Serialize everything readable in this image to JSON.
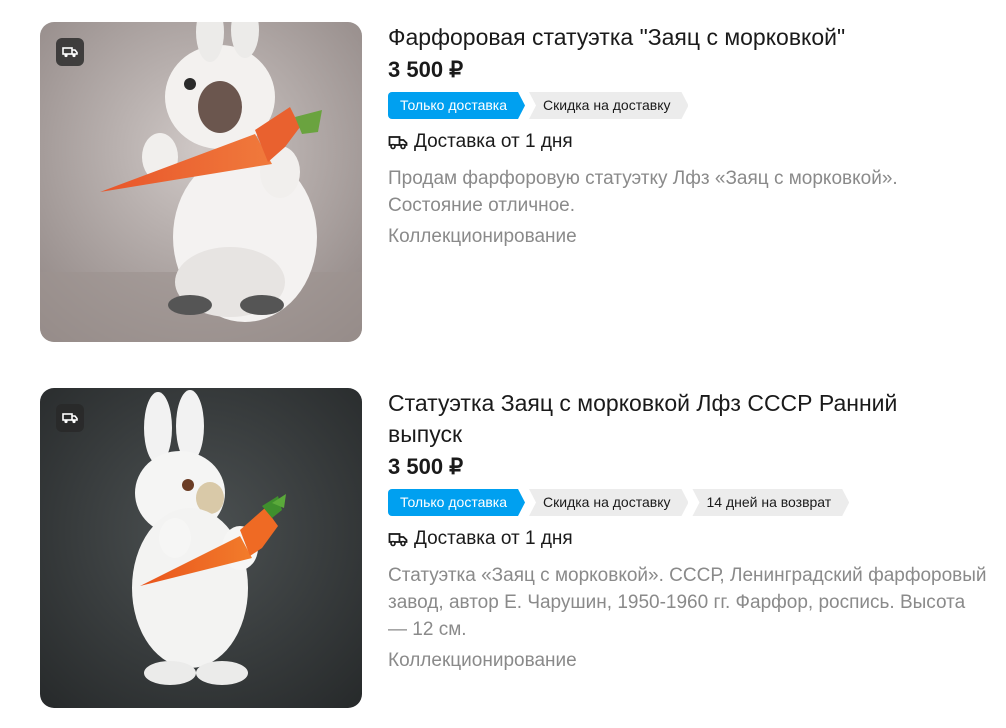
{
  "colors": {
    "accent_badge": "#00a0f0",
    "badge_bg": "#ececec",
    "muted_text": "#8a8a8a"
  },
  "listings": [
    {
      "image_icon": "rabbit-figurine-photo",
      "title": "Фарфоровая статуэтка \"Заяц с морковкой\"",
      "price": "3 500 ₽",
      "badges": [
        "Только доставка",
        "Скидка на доставку"
      ],
      "delivery_icon": "truck-icon",
      "delivery": "Доставка от 1 дня",
      "description": "Продам фарфоровую статуэтку Лфз «Заяц с морковкой». Состояние отличное.",
      "category": "Коллекционирование"
    },
    {
      "image_icon": "rabbit-figurine-photo",
      "title": "Статуэтка Заяц с морковкой Лфз СССР Ранний выпуск",
      "price": "3 500 ₽",
      "badges": [
        "Только доставка",
        "Скидка на доставку",
        "14 дней на возврат"
      ],
      "delivery_icon": "truck-icon",
      "delivery": "Доставка от 1 дня",
      "description": "Статуэтка «Заяц с морковкой». СССР, Ленинградский фарфоровый завод, автор Е. Чарушин, 1950-1960 гг. Фарфор, роспись. Высота — 12 см.",
      "category": "Коллекционирование"
    }
  ]
}
